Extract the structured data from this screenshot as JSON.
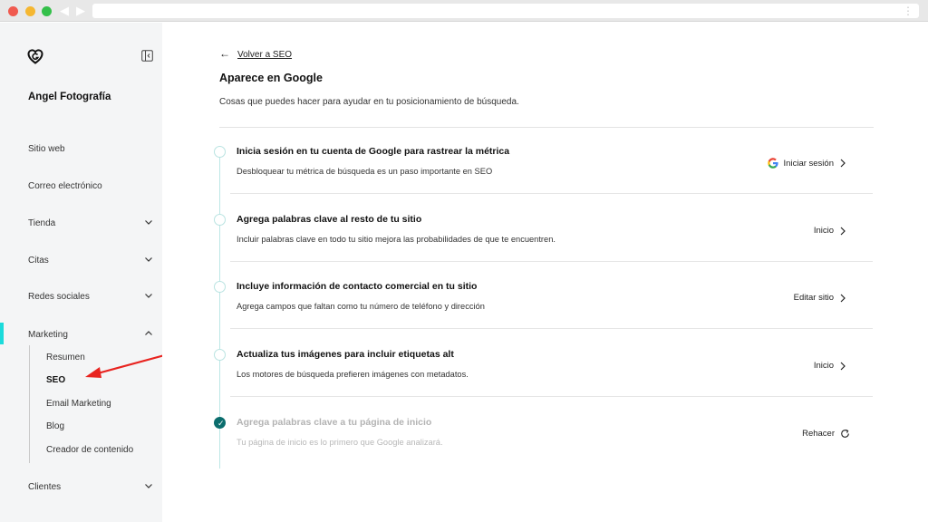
{
  "sidebar": {
    "site_name": "Angel Fotografía",
    "items": [
      {
        "label": "Sitio web"
      },
      {
        "label": "Correo electrónico"
      },
      {
        "label": "Tienda"
      },
      {
        "label": "Citas"
      },
      {
        "label": "Redes sociales"
      },
      {
        "label": "Marketing"
      },
      {
        "label": "Clientes"
      }
    ],
    "marketing_sub": [
      {
        "label": "Resumen"
      },
      {
        "label": "SEO"
      },
      {
        "label": "Email Marketing"
      },
      {
        "label": "Blog"
      },
      {
        "label": "Creador de contenido"
      }
    ]
  },
  "main": {
    "back_label": "Volver a SEO",
    "title": "Aparece en Google",
    "description": "Cosas que puedes hacer para ayudar en tu posicionamiento de búsqueda.",
    "tasks": [
      {
        "title": "Inicia sesión en tu cuenta de Google para rastrear la métrica",
        "desc": "Desbloquear tu métrica de búsqueda es un paso importante en SEO",
        "action": "Iniciar sesión"
      },
      {
        "title": "Agrega palabras clave al resto de tu sitio",
        "desc": "Incluir palabras clave en todo tu sitio mejora las probabilidades de que te encuentren.",
        "action": "Inicio"
      },
      {
        "title": "Incluye información de contacto comercial en tu sitio",
        "desc": "Agrega campos que faltan como tu número de teléfono y dirección",
        "action": "Editar sitio"
      },
      {
        "title": "Actualiza tus imágenes para incluir etiquetas alt",
        "desc": "Los motores de búsqueda prefieren imágenes con metadatos.",
        "action": "Inicio"
      },
      {
        "title": "Agrega palabras clave a tu página de inicio",
        "desc": "Tu página de inicio es lo primero que Google analizará.",
        "action": "Rehacer"
      }
    ]
  },
  "colors": {
    "accent": "#1bdbdb",
    "done": "#0b6d6d",
    "annotation": "#e8231f"
  }
}
